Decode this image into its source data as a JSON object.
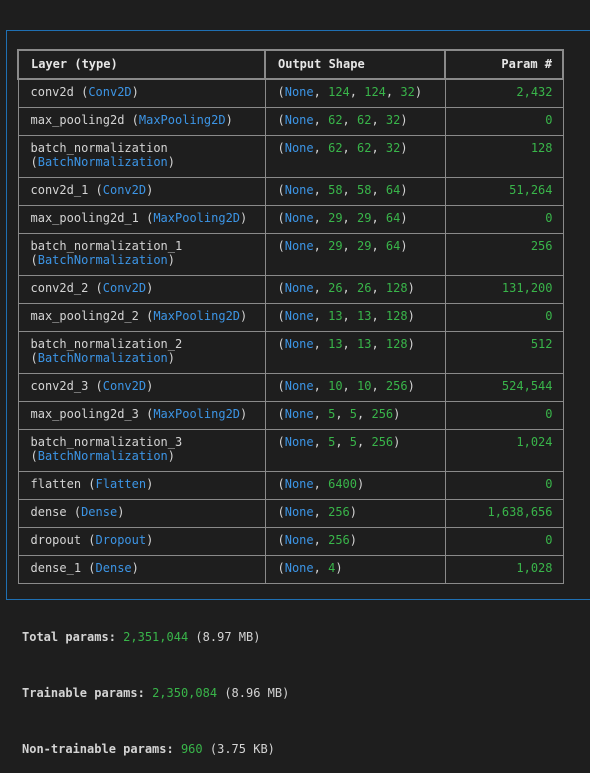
{
  "table": {
    "headers": {
      "layer": "Layer (type)",
      "shape": "Output Shape",
      "param": "Param #"
    },
    "rows": [
      {
        "name": "conv2d",
        "type": "Conv2D",
        "shape": [
          124,
          124,
          32
        ],
        "params": "2,432"
      },
      {
        "name": "max_pooling2d",
        "type": "MaxPooling2D",
        "shape": [
          62,
          62,
          32
        ],
        "params": "0"
      },
      {
        "name": "batch_normalization",
        "type": "BatchNormalization",
        "shape": [
          62,
          62,
          32
        ],
        "params": "128",
        "wrap": true
      },
      {
        "name": "conv2d_1",
        "type": "Conv2D",
        "shape": [
          58,
          58,
          64
        ],
        "params": "51,264"
      },
      {
        "name": "max_pooling2d_1",
        "type": "MaxPooling2D",
        "shape": [
          29,
          29,
          64
        ],
        "params": "0"
      },
      {
        "name": "batch_normalization_1",
        "type": "BatchNormalization",
        "shape": [
          29,
          29,
          64
        ],
        "params": "256",
        "wrap": true
      },
      {
        "name": "conv2d_2",
        "type": "Conv2D",
        "shape": [
          26,
          26,
          128
        ],
        "params": "131,200"
      },
      {
        "name": "max_pooling2d_2",
        "type": "MaxPooling2D",
        "shape": [
          13,
          13,
          128
        ],
        "params": "0"
      },
      {
        "name": "batch_normalization_2",
        "type": "BatchNormalization",
        "shape": [
          13,
          13,
          128
        ],
        "params": "512",
        "wrap": true
      },
      {
        "name": "conv2d_3",
        "type": "Conv2D",
        "shape": [
          10,
          10,
          256
        ],
        "params": "524,544"
      },
      {
        "name": "max_pooling2d_3",
        "type": "MaxPooling2D",
        "shape": [
          5,
          5,
          256
        ],
        "params": "0"
      },
      {
        "name": "batch_normalization_3",
        "type": "BatchNormalization",
        "shape": [
          5,
          5,
          256
        ],
        "params": "1,024",
        "wrap": true
      },
      {
        "name": "flatten",
        "type": "Flatten",
        "shape": [
          6400
        ],
        "params": "0"
      },
      {
        "name": "dense",
        "type": "Dense",
        "shape": [
          256
        ],
        "params": "1,638,656"
      },
      {
        "name": "dropout",
        "type": "Dropout",
        "shape": [
          256
        ],
        "params": "0"
      },
      {
        "name": "dense_1",
        "type": "Dense",
        "shape": [
          4
        ],
        "params": "1,028"
      }
    ],
    "none_token": "None"
  },
  "summary": {
    "total": {
      "label": "Total params:",
      "value": "2,351,044",
      "size": "(8.97 MB)"
    },
    "trainable": {
      "label": "Trainable params:",
      "value": "2,350,084",
      "size": "(8.96 MB)"
    },
    "non_trainable": {
      "label": "Non-trainable params:",
      "value": "960",
      "size": "(3.75 KB)"
    }
  },
  "colors": {
    "background": "#1e1e1e",
    "class_name": "#3c95e6",
    "number": "#39b54a",
    "border": "#8a8a8a",
    "frame": "#1f6fb2"
  }
}
